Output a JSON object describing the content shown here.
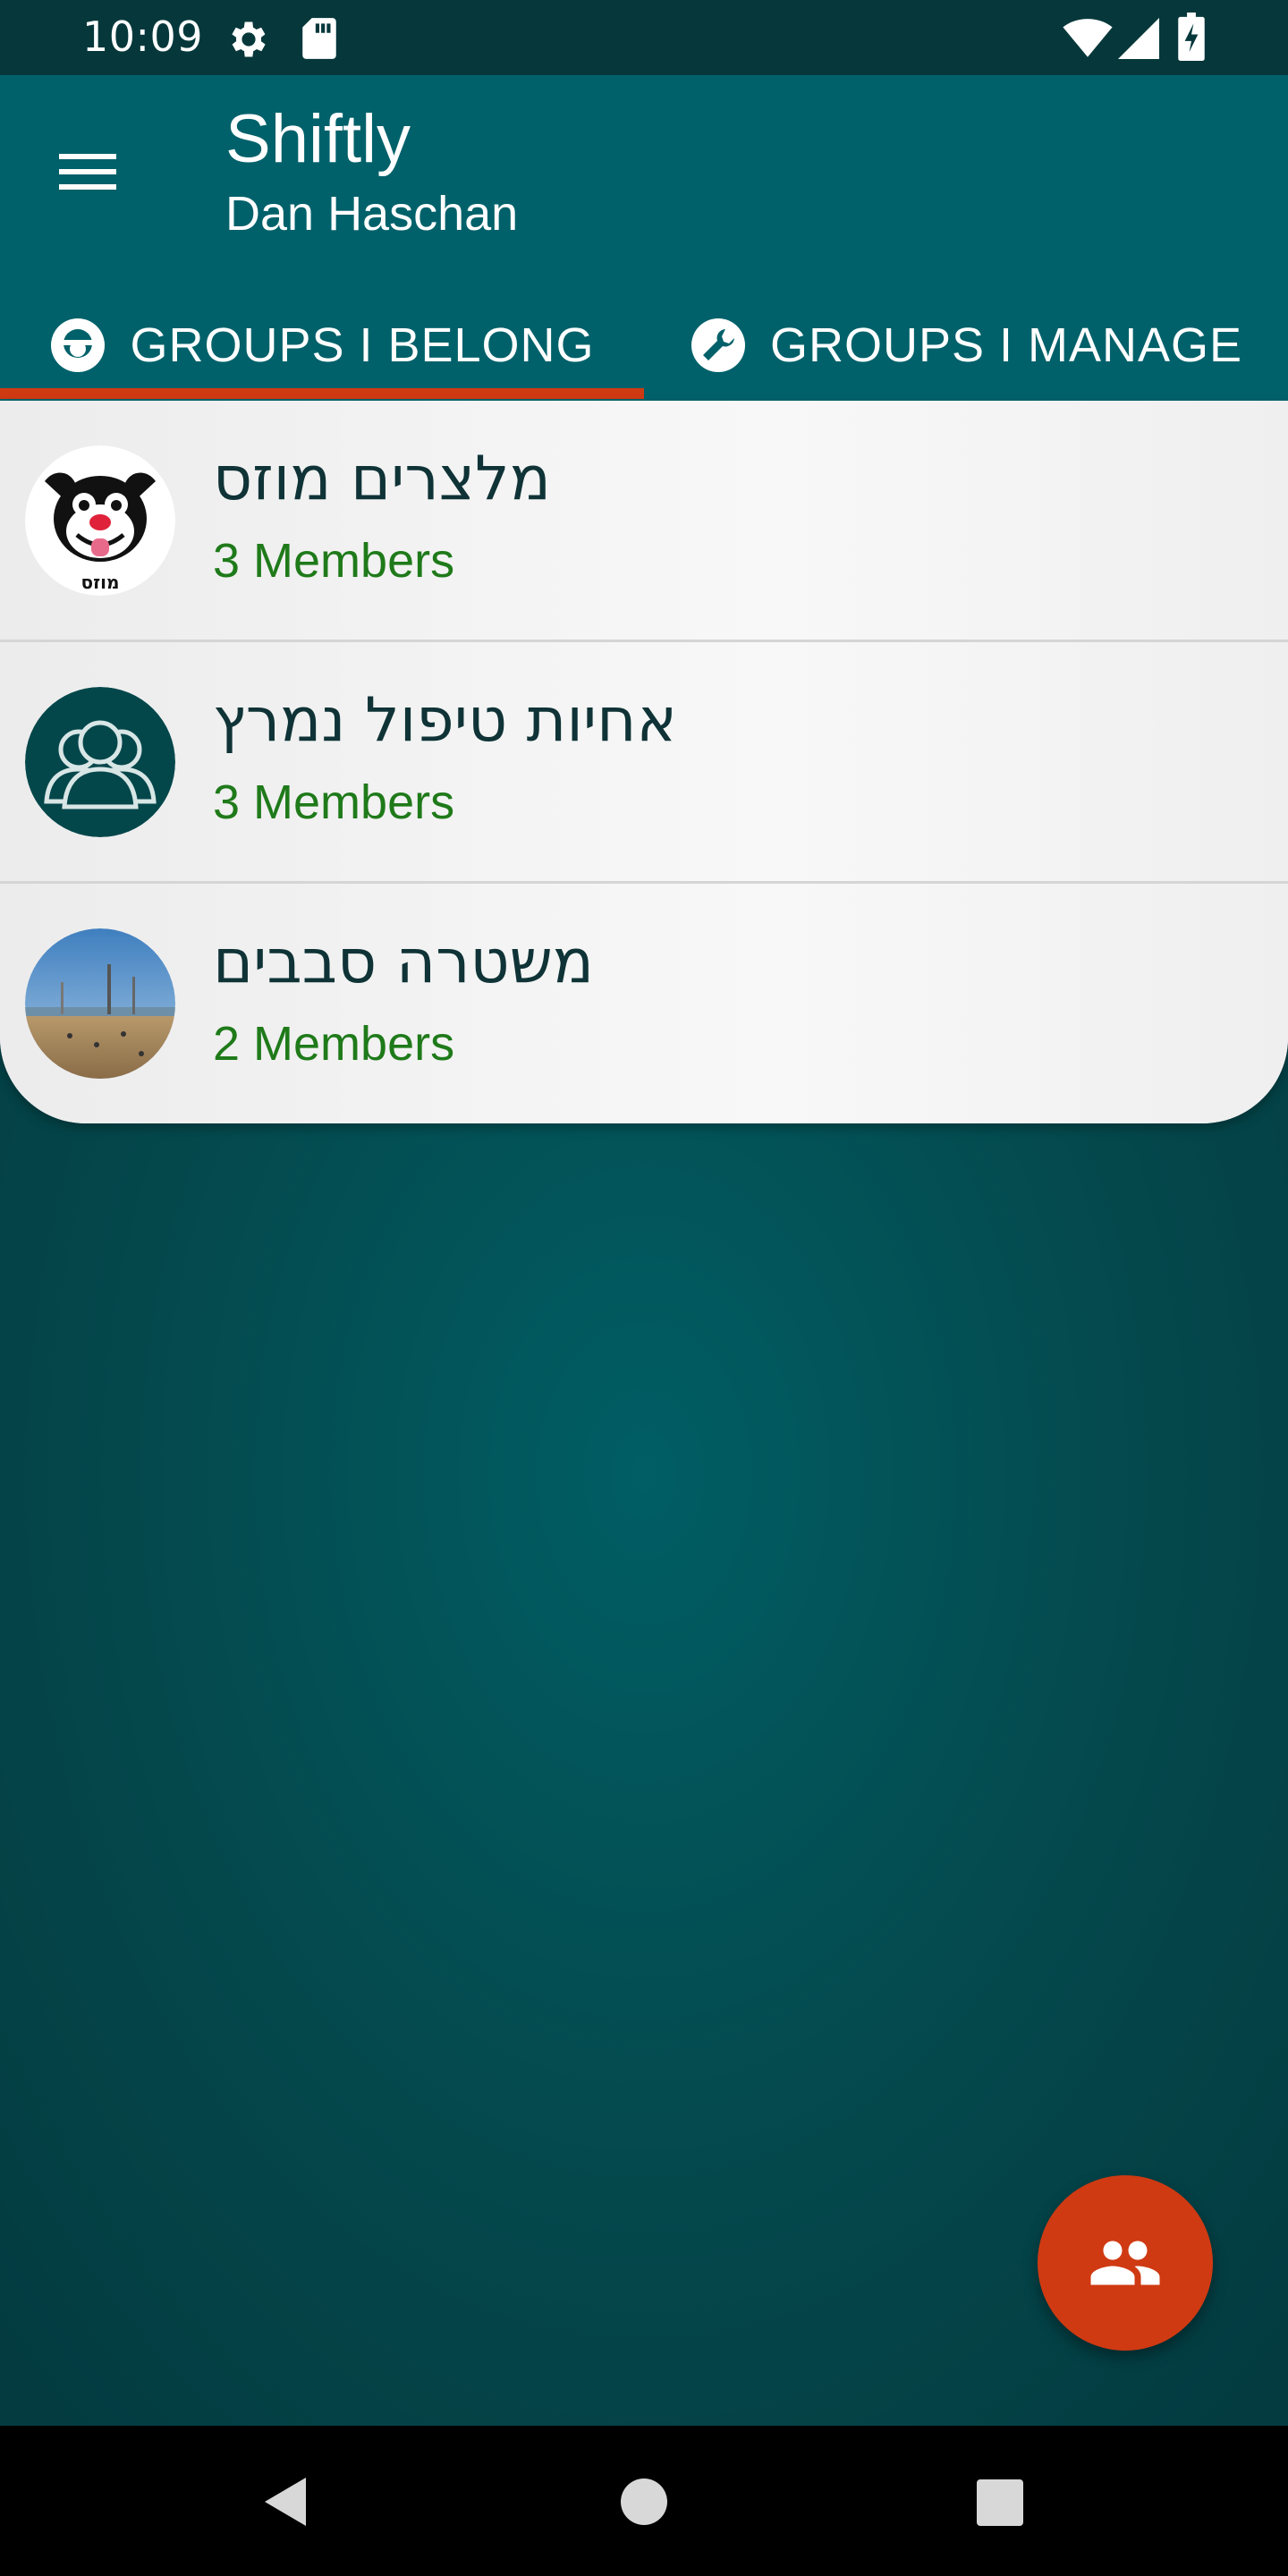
{
  "status_bar": {
    "time": "10:09",
    "icons": [
      "settings-icon",
      "sd-card-icon",
      "wifi-icon",
      "signal-icon",
      "battery-charging-icon"
    ]
  },
  "app_bar": {
    "title": "Shiftly",
    "subtitle": "Dan Haschan",
    "menu_icon": "hamburger-menu-icon"
  },
  "tabs": [
    {
      "label": "GROUPS I BELONG",
      "icon": "member-badge-icon",
      "selected": true
    },
    {
      "label": "GROUPS I MANAGE",
      "icon": "manage-wrench-icon",
      "selected": false
    }
  ],
  "groups": [
    {
      "name": "מלצרים מוזס",
      "members": "3 Members",
      "avatar": "dog-cartoon-avatar"
    },
    {
      "name": "אחיות טיפול נמרץ",
      "members": "3 Members",
      "avatar": "group-people-avatar"
    },
    {
      "name": "משטרה סבבים",
      "members": "2 Members",
      "avatar": "beach-photo-avatar"
    }
  ],
  "fab": {
    "icon": "group-add-icon"
  },
  "nav_bar": {
    "buttons": [
      "back-icon",
      "home-icon",
      "recents-icon"
    ]
  },
  "colors": {
    "primary": "#00616a",
    "accent": "#cf3a12",
    "members_text": "#1f7a1a",
    "status_bar": "#06383b"
  }
}
